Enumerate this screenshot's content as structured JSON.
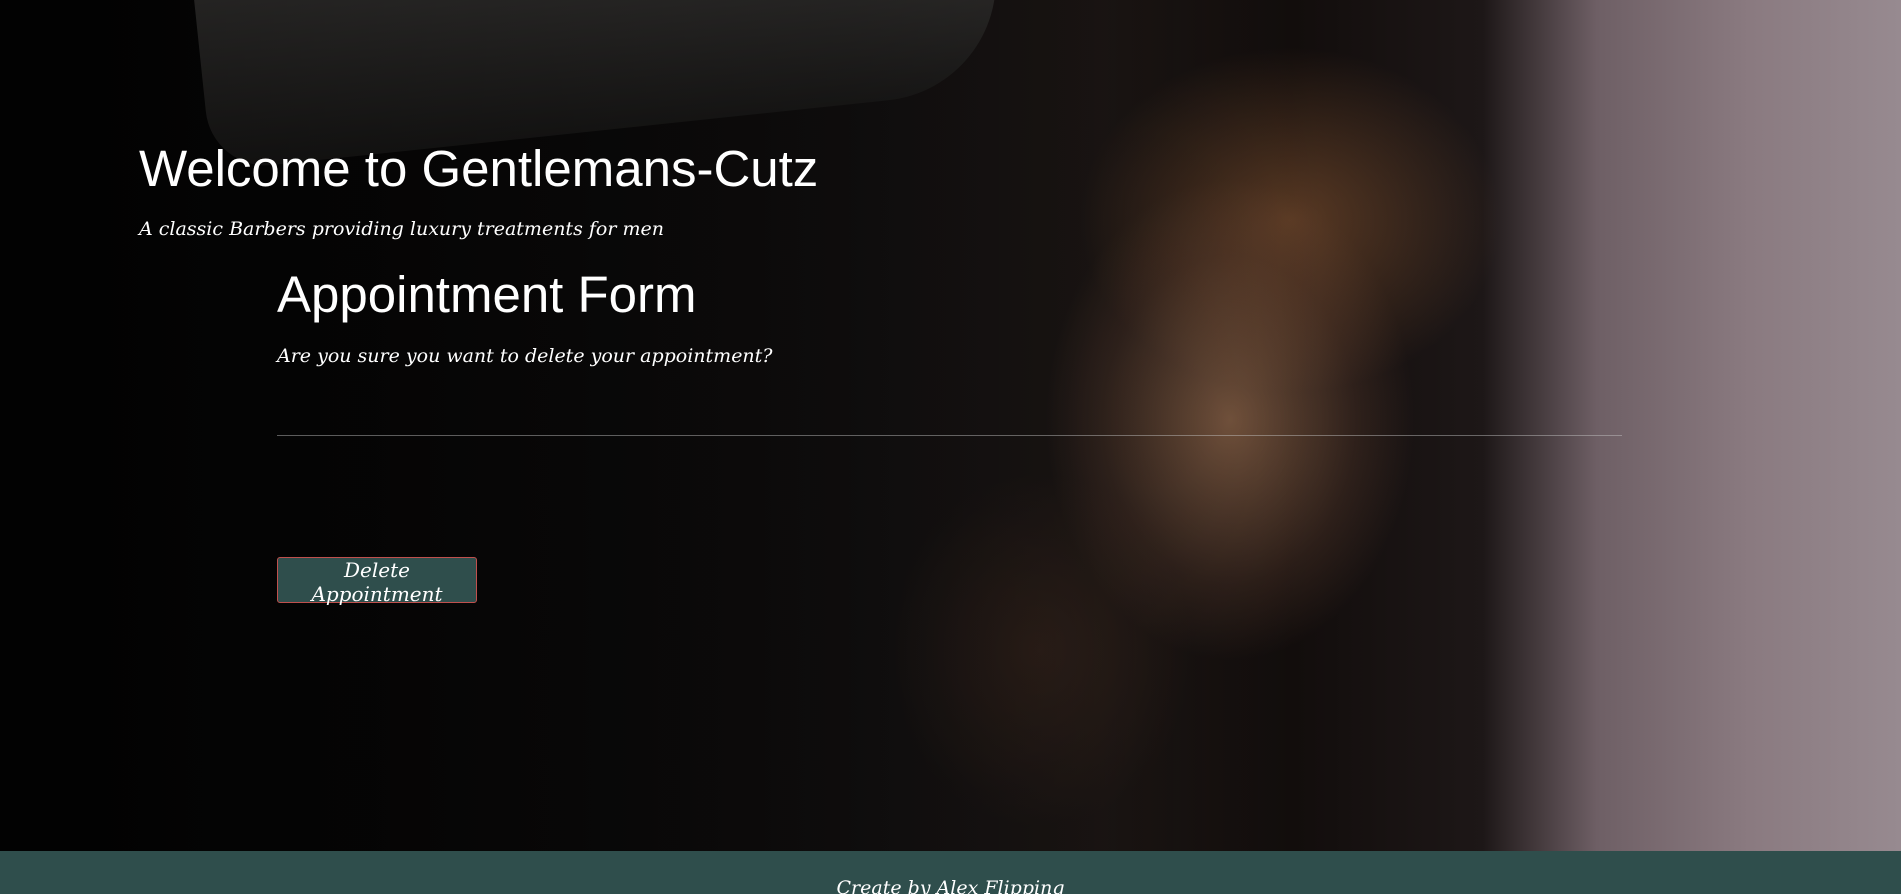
{
  "header": {
    "title": "Welcome to Gentlemans-Cutz",
    "tagline": "A classic Barbers providing luxury treatments for men"
  },
  "form": {
    "title": "Appointment Form",
    "question": "Are you sure you want to delete your appointment?",
    "delete_button_label": "Delete Appointment"
  },
  "footer": {
    "credit": "Create by Alex Flipping"
  },
  "colors": {
    "accent": "#2f4e4c",
    "button_border": "#c0504d",
    "text": "#ffffff"
  }
}
